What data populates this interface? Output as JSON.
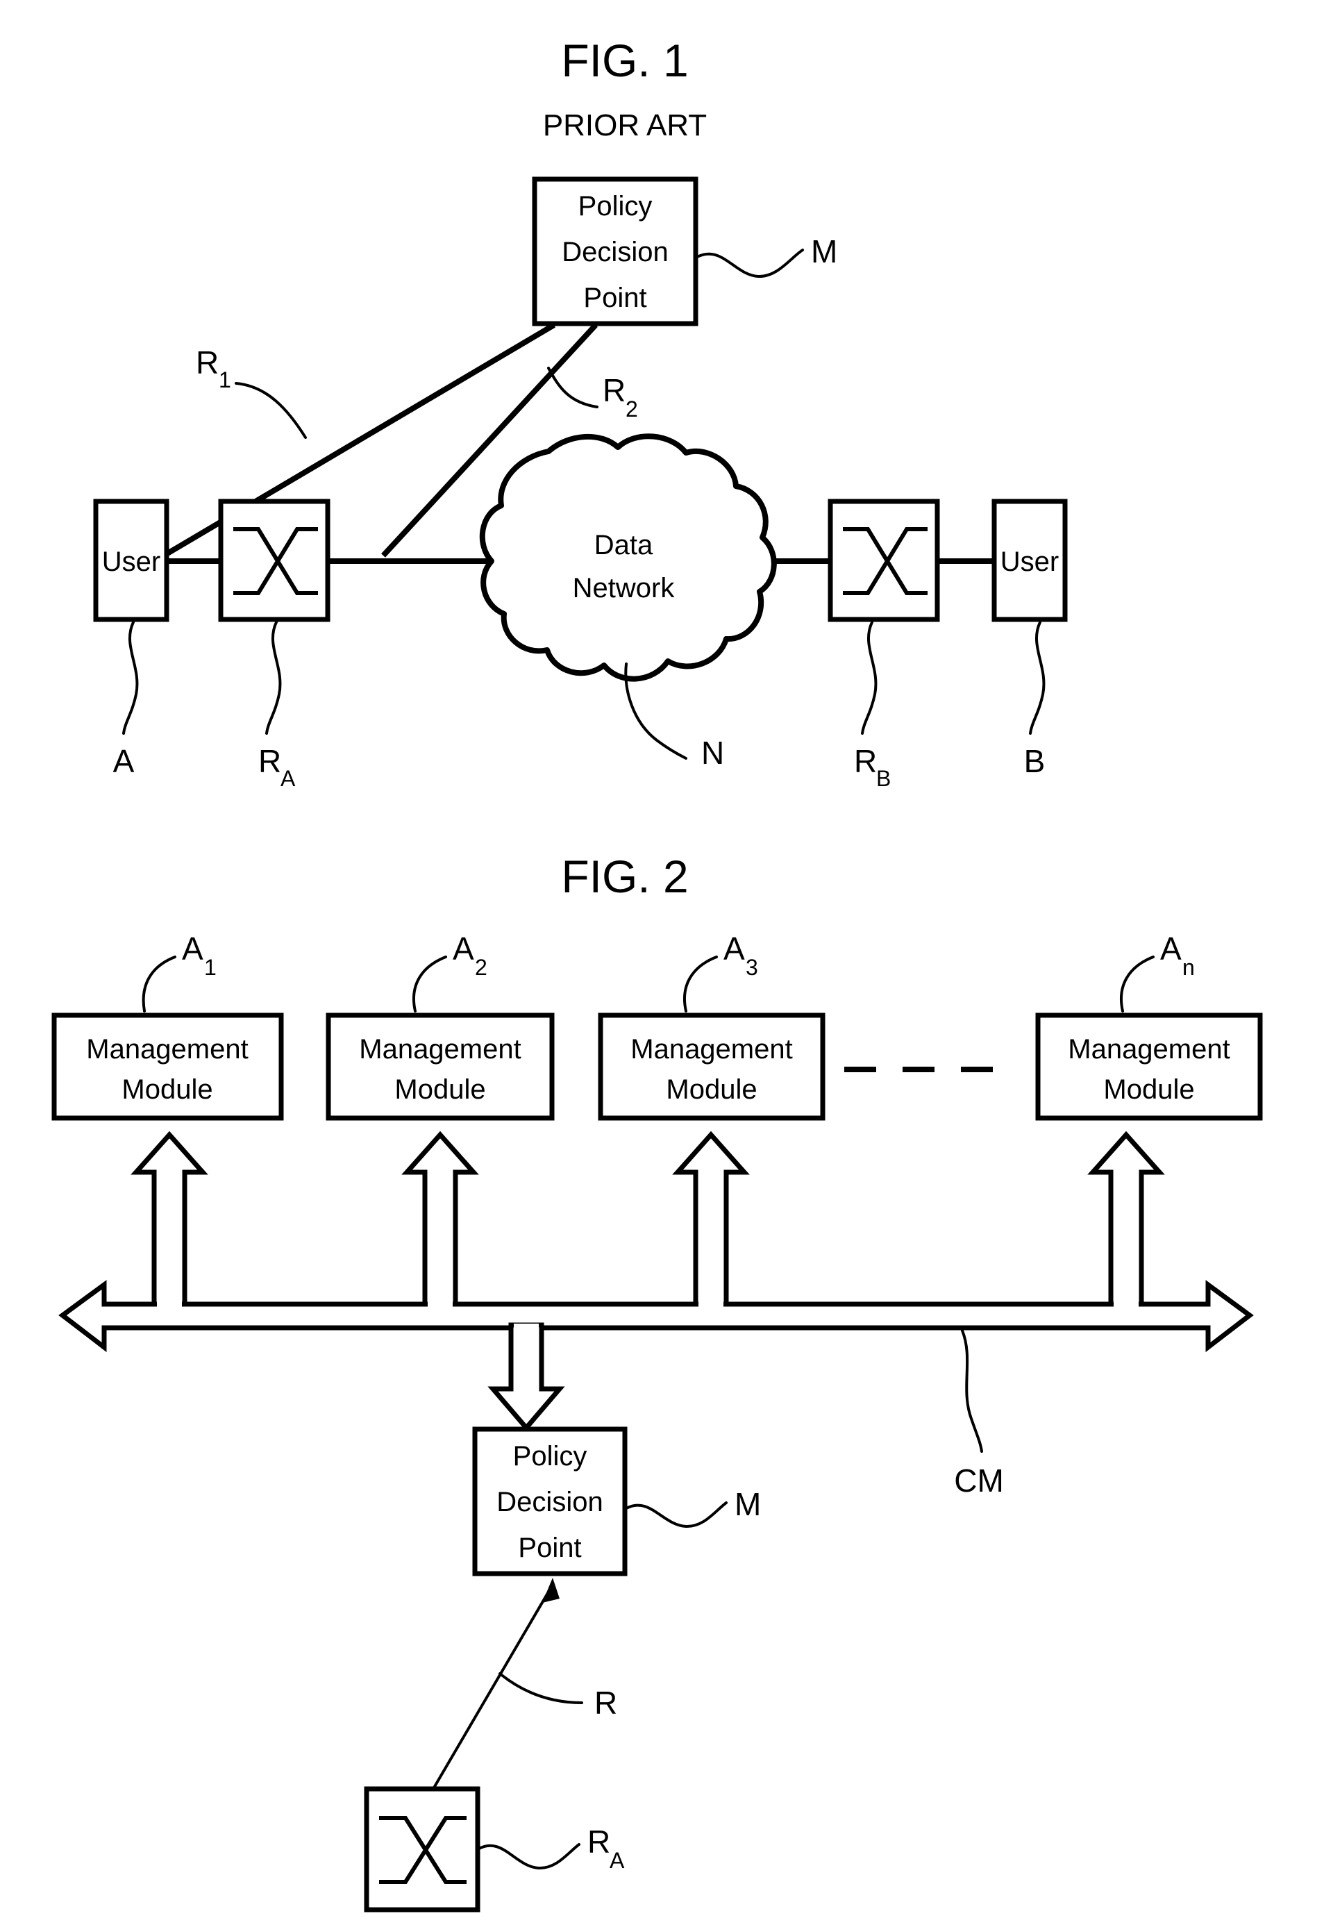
{
  "figures": [
    {
      "id": "fig1",
      "title": "FIG. 1",
      "subtitle": "PRIOR ART",
      "nodes": {
        "policy_decision_point": "Policy\nDecision\nPoint",
        "pdp_line1": "Policy",
        "pdp_line2": "Decision",
        "pdp_line3": "Point",
        "user_left": "User",
        "user_right": "User",
        "cloud_line1": "Data",
        "cloud_line2": "Network",
        "router_left_icon": "router-cross-icon",
        "router_right_icon": "router-cross-icon"
      },
      "reference_labels": {
        "pdp": "M",
        "link1_base": "R",
        "link1_sub": "1",
        "link2_base": "R",
        "link2_sub": "2",
        "user_left": "A",
        "router_left_base": "R",
        "router_left_sub": "A",
        "network": "N",
        "router_right_base": "R",
        "router_right_sub": "B",
        "user_right": "B"
      }
    },
    {
      "id": "fig2",
      "title": "FIG. 2",
      "subtitle": "",
      "nodes": {
        "management_modules": [
          {
            "line1": "Management",
            "line2": "Module",
            "ref_base": "A",
            "ref_sub": "1"
          },
          {
            "line1": "Management",
            "line2": "Module",
            "ref_base": "A",
            "ref_sub": "2"
          },
          {
            "line1": "Management",
            "line2": "Module",
            "ref_base": "A",
            "ref_sub": "3"
          },
          {
            "line1": "Management",
            "line2": "Module",
            "ref_base": "A",
            "ref_sub": "n"
          }
        ],
        "ellipsis": "— — —",
        "pdp_line1": "Policy",
        "pdp_line2": "Decision",
        "pdp_line3": "Point",
        "router_icon": "router-cross-icon"
      },
      "reference_labels": {
        "bus": "CM",
        "pdp": "M",
        "router_link": "R",
        "router_base": "R",
        "router_sub": "A"
      }
    }
  ],
  "colors": {
    "ink": "#000000",
    "paper": "#ffffff"
  }
}
